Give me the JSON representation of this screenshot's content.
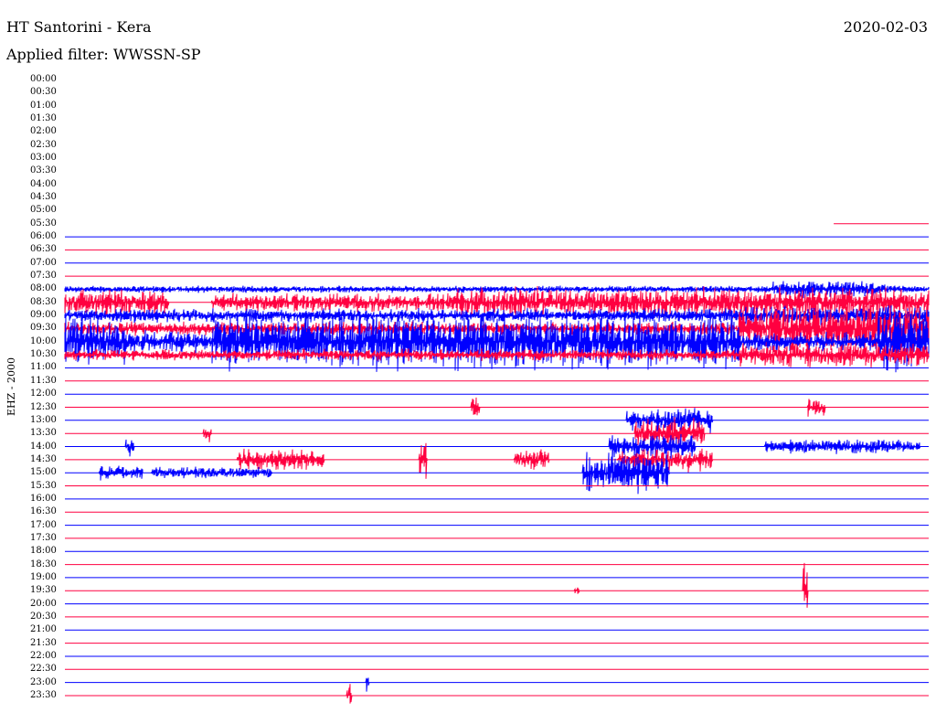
{
  "header": {
    "title": "HT Santorini - Kera",
    "filter": "Applied filter: WWSSN-SP",
    "date": "2020-02-03"
  },
  "chart_data": {
    "type": "line",
    "title": "HT Santorini - Kera",
    "subtitle": "Applied filter: WWSSN-SP",
    "ylabel": "EHZ - 2000",
    "row_minutes": 30,
    "colors": {
      "hour": "#0000ff",
      "half_hour": "#ff0040"
    },
    "time_labels": [
      "00:00",
      "00:30",
      "01:00",
      "01:30",
      "02:00",
      "02:30",
      "03:00",
      "03:30",
      "04:00",
      "04:30",
      "05:00",
      "05:30",
      "06:00",
      "06:30",
      "07:00",
      "07:30",
      "08:00",
      "08:30",
      "09:00",
      "09:30",
      "10:00",
      "10:30",
      "11:00",
      "11:30",
      "12:00",
      "12:30",
      "13:00",
      "13:30",
      "14:00",
      "14:30",
      "15:00",
      "15:30",
      "16:00",
      "16:30",
      "17:00",
      "17:30",
      "18:00",
      "18:30",
      "19:00",
      "19:30",
      "20:00",
      "20:30",
      "21:00",
      "21:30",
      "22:00",
      "22:30",
      "23:00",
      "23:30"
    ],
    "data_start_row": "05:30",
    "data_start_fraction": 0.89,
    "activity_note": "relative amplitude in row-spacing units; start/end as fraction of 30-min row",
    "activity": [
      {
        "row": "08:00",
        "segments": [
          [
            0.0,
            1.0,
            0.3
          ],
          [
            0.82,
            0.95,
            0.7
          ]
        ]
      },
      {
        "row": "08:30",
        "segments": [
          [
            0.0,
            0.12,
            1.2
          ],
          [
            0.17,
            0.65,
            0.8
          ],
          [
            0.45,
            1.0,
            1.3
          ]
        ]
      },
      {
        "row": "09:00",
        "segments": [
          [
            0.0,
            0.78,
            0.6
          ],
          [
            0.78,
            1.0,
            0.8
          ]
        ]
      },
      {
        "row": "09:30",
        "segments": [
          [
            0.0,
            0.78,
            0.6
          ],
          [
            0.78,
            1.0,
            2.3
          ]
        ]
      },
      {
        "row": "10:00",
        "segments": [
          [
            0.0,
            0.07,
            2.2
          ],
          [
            0.07,
            0.17,
            1.0
          ],
          [
            0.17,
            0.78,
            2.4
          ],
          [
            0.78,
            1.0,
            0.8
          ],
          [
            0.94,
            1.0,
            2.6
          ]
        ]
      },
      {
        "row": "10:30",
        "segments": [
          [
            0.0,
            0.78,
            0.5
          ],
          [
            0.78,
            1.0,
            1.0
          ]
        ]
      },
      {
        "row": "12:30",
        "segments": [
          [
            0.47,
            0.48,
            1.0
          ],
          [
            0.86,
            0.88,
            0.8
          ]
        ]
      },
      {
        "row": "13:00",
        "segments": [
          [
            0.65,
            0.75,
            1.1
          ]
        ]
      },
      {
        "row": "13:30",
        "segments": [
          [
            0.16,
            0.17,
            1.0
          ],
          [
            0.66,
            0.74,
            1.3
          ]
        ]
      },
      {
        "row": "14:00",
        "segments": [
          [
            0.07,
            0.08,
            0.8
          ],
          [
            0.63,
            0.73,
            1.1
          ],
          [
            0.81,
            0.99,
            0.6
          ]
        ]
      },
      {
        "row": "14:30",
        "segments": [
          [
            0.2,
            0.3,
            0.9
          ],
          [
            0.52,
            0.56,
            0.8
          ],
          [
            0.64,
            0.75,
            1.0
          ],
          [
            0.41,
            0.42,
            1.6
          ]
        ]
      },
      {
        "row": "15:00",
        "segments": [
          [
            0.04,
            0.09,
            0.6
          ],
          [
            0.1,
            0.24,
            0.5
          ],
          [
            0.6,
            0.7,
            1.8
          ]
        ]
      },
      {
        "row": "19:30",
        "segments": [
          [
            0.855,
            0.86,
            3.5
          ],
          [
            0.59,
            0.595,
            0.4
          ]
        ]
      },
      {
        "row": "23:00",
        "segments": [
          [
            0.349,
            0.352,
            1.0
          ]
        ]
      },
      {
        "row": "23:30",
        "segments": [
          [
            0.326,
            0.332,
            1.1
          ]
        ]
      }
    ]
  }
}
